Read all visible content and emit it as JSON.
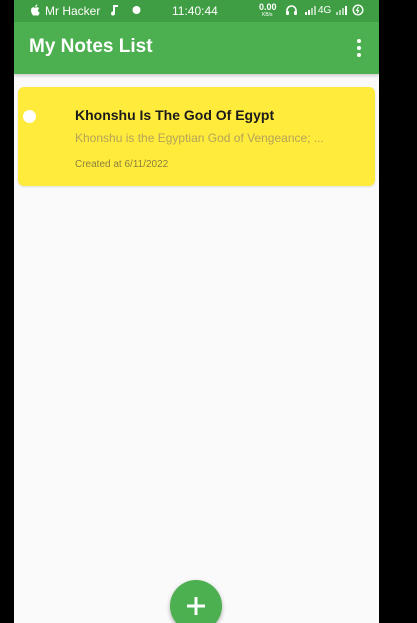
{
  "status_bar": {
    "carrier": "Mr Hacker",
    "time": "11:40:44",
    "speed_value": "0.00",
    "speed_unit": "KB/s",
    "network": "4G"
  },
  "app_bar": {
    "title": "My Notes List",
    "menu_icon": "more-vertical-icon"
  },
  "notes": [
    {
      "title": "Khonshu Is The God Of Egypt",
      "preview": "Khonshu is the Egyptian God of Vengeance; ...",
      "created": "Created at 6/11/2022"
    }
  ],
  "fab": {
    "icon": "plus-icon"
  },
  "colors": {
    "primary": "#4caf50",
    "status_bar": "#3f9e43",
    "note_background": "#ffeb3b",
    "background": "#fafafa"
  }
}
